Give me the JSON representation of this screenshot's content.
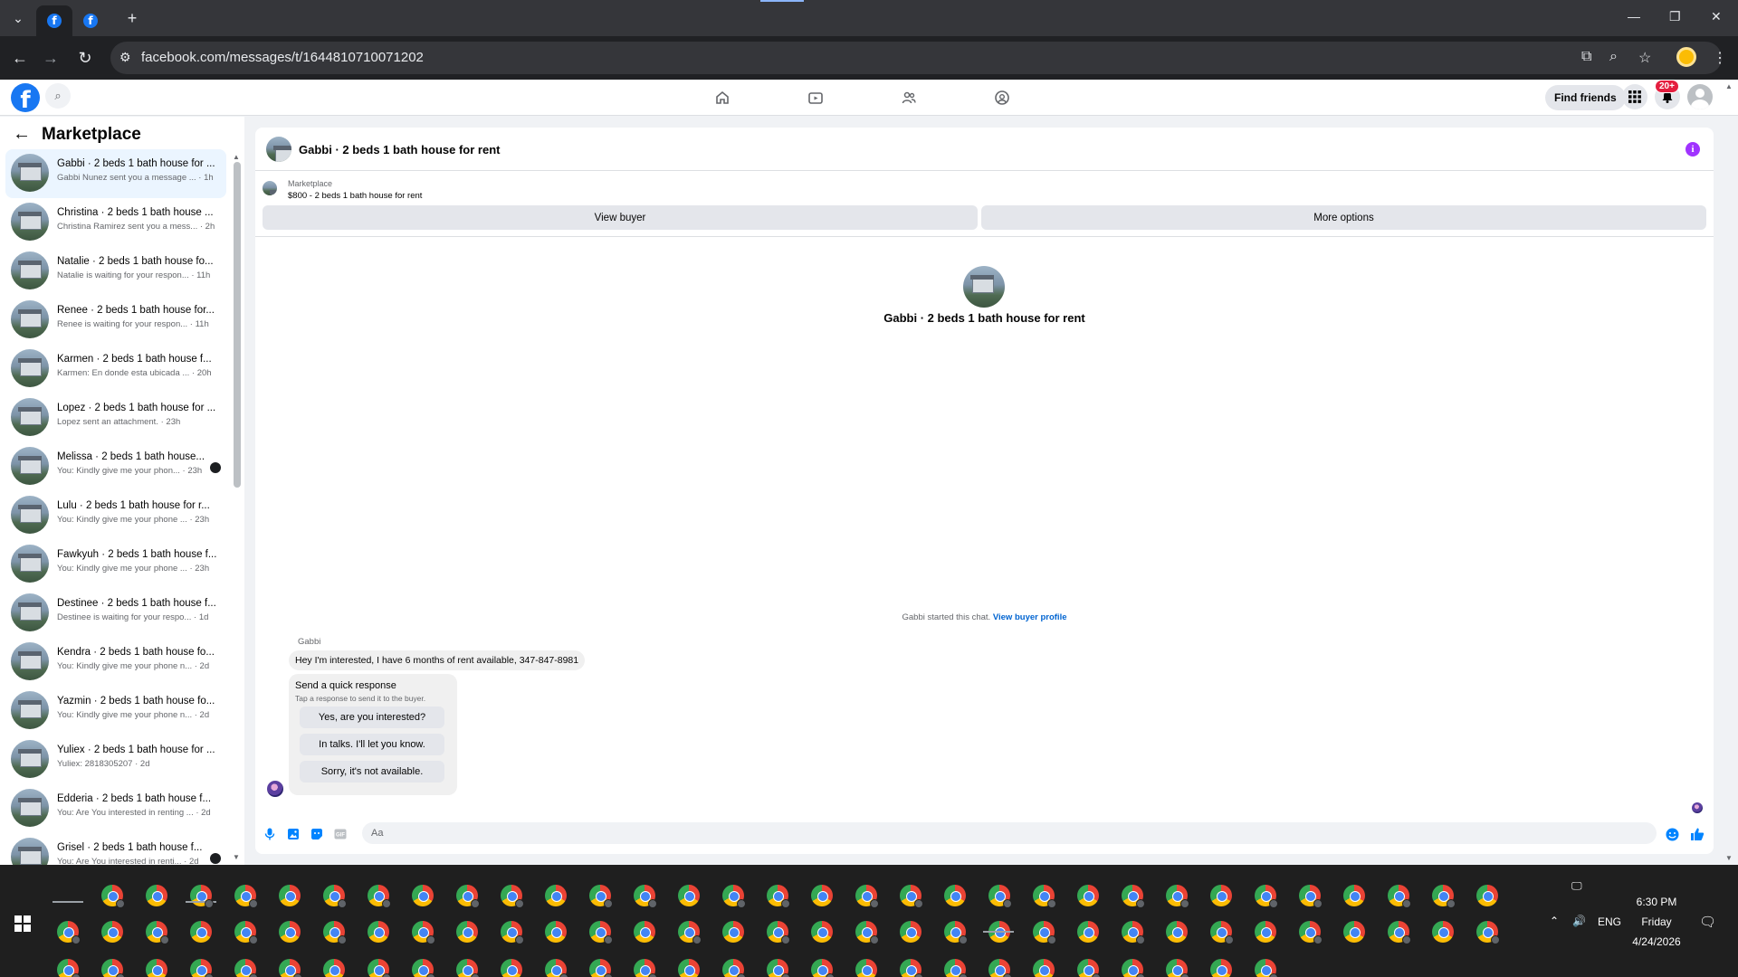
{
  "browser": {
    "url": "facebook.com/messages/t/1644810710071202"
  },
  "fb_header": {
    "find_friends": "Find friends",
    "notif_badge": "20+"
  },
  "sidebar": {
    "title": "Marketplace",
    "conversations": [
      {
        "title": "Gabbi · 2 beds 1 bath house for ...",
        "sub": "Gabbi Nunez sent you a message ... · 1h"
      },
      {
        "title": "Christina · 2 beds 1 bath house ...",
        "sub": "Christina Ramirez sent you a mess... · 2h"
      },
      {
        "title": "Natalie · 2 beds 1 bath house fo...",
        "sub": "Natalie is waiting for your respon... · 11h"
      },
      {
        "title": "Renee · 2 beds 1 bath house for...",
        "sub": "Renee is waiting for your respon... · 11h"
      },
      {
        "title": "Karmen · 2 beds 1 bath house f...",
        "sub": "Karmen: En donde esta ubicada ... · 20h"
      },
      {
        "title": "Lopez · 2 beds 1 bath house for ...",
        "sub": "Lopez sent an attachment. · 23h"
      },
      {
        "title": "Melissa · 2 beds 1 bath house...",
        "sub": "You: Kindly give me your phon... · 23h"
      },
      {
        "title": "Lulu · 2 beds 1 bath house for r...",
        "sub": "You: Kindly give me your phone ... · 23h"
      },
      {
        "title": "Fawkyuh · 2 beds 1 bath house f...",
        "sub": "You: Kindly give me your phone ... · 23h"
      },
      {
        "title": "Destinee · 2 beds 1 bath house f...",
        "sub": "Destinee is waiting for your respo... · 1d"
      },
      {
        "title": "Kendra · 2 beds 1 bath house fo...",
        "sub": "You: Kindly give me your phone n... · 2d"
      },
      {
        "title": "Yazmin · 2 beds 1 bath house fo...",
        "sub": "You: Kindly give me your phone n... · 2d"
      },
      {
        "title": "Yuliex · 2 beds 1 bath house for ...",
        "sub": "Yuliex: 2818305207 · 2d"
      },
      {
        "title": "Edderia · 2 beds 1 bath house f...",
        "sub": "You: Are You interested in renting ... · 2d"
      },
      {
        "title": "Grisel · 2 beds 1 bath house f...",
        "sub": "You: Are You interested in renti... · 2d"
      }
    ]
  },
  "chat": {
    "title": "Gabbi · 2 beds 1 bath house for rent",
    "marketplace_label": "Marketplace",
    "listing": "$800 - 2 beds 1 bath house for rent",
    "view_buyer": "View buyer",
    "more_options": "More options",
    "center_name": "Gabbi · 2 beds 1 bath house for rent",
    "started_text": "Gabbi started this chat.",
    "view_buyer_profile": "View buyer profile",
    "sender": "Gabbi",
    "message": "Hey I'm interested, I have 6 months of rent available, 347-847-8981",
    "quick_title": "Send a quick response",
    "quick_sub": "Tap a response to send it to the buyer.",
    "quick_options": [
      "Yes, are you interested?",
      "In talks. I'll let you know.",
      "Sorry, it's not available."
    ],
    "composer_placeholder": "Aa"
  },
  "taskbar": {
    "time": "6:30 PM",
    "day": "Friday",
    "date": "4/24/2026",
    "lang": "ENG"
  }
}
